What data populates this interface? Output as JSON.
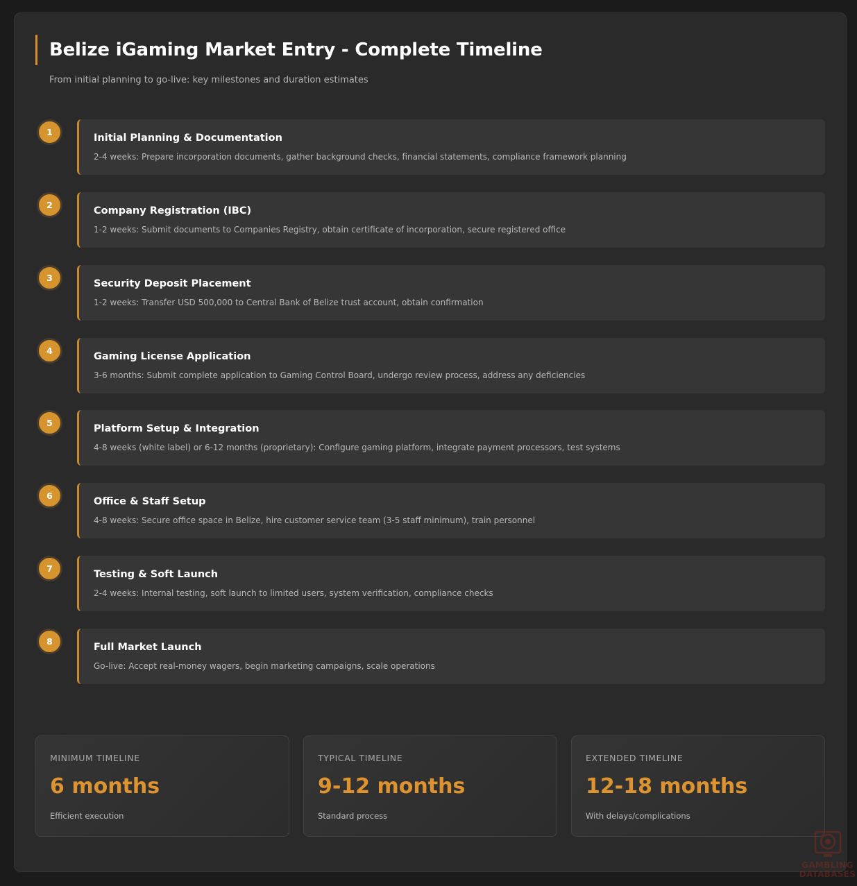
{
  "header": {
    "title": "Belize iGaming Market Entry - Complete Timeline",
    "subtitle": "From initial planning to go-live: key milestones and duration estimates"
  },
  "milestones": [
    {
      "number": "1",
      "title": "Initial Planning & Documentation",
      "description": "2-4 weeks: Prepare incorporation documents, gather background checks, financial statements, compliance framework planning"
    },
    {
      "number": "2",
      "title": "Company Registration (IBC)",
      "description": "1-2 weeks: Submit documents to Companies Registry, obtain certificate of incorporation, secure registered office"
    },
    {
      "number": "3",
      "title": "Security Deposit Placement",
      "description": "1-2 weeks: Transfer USD 500,000 to Central Bank of Belize trust account, obtain confirmation"
    },
    {
      "number": "4",
      "title": "Gaming License Application",
      "description": "3-6 months: Submit complete application to Gaming Control Board, undergo review process, address any deficiencies"
    },
    {
      "number": "5",
      "title": "Platform Setup & Integration",
      "description": "4-8 weeks (white label) or 6-12 months (proprietary): Configure gaming platform, integrate payment processors, test systems"
    },
    {
      "number": "6",
      "title": "Office & Staff Setup",
      "description": "4-8 weeks: Secure office space in Belize, hire customer service team (3-5 staff minimum), train personnel"
    },
    {
      "number": "7",
      "title": "Testing & Soft Launch",
      "description": "2-4 weeks: Internal testing, soft launch to limited users, system verification, compliance checks"
    },
    {
      "number": "8",
      "title": "Full Market Launch",
      "description": "Go-live: Accept real-money wagers, begin marketing campaigns, scale operations"
    }
  ],
  "stats": [
    {
      "label": "MINIMUM TIMELINE",
      "value": "6 months",
      "note": "Efficient execution"
    },
    {
      "label": "TYPICAL TIMELINE",
      "value": "9-12 months",
      "note": "Standard process"
    },
    {
      "label": "EXTENDED TIMELINE",
      "value": "12-18 months",
      "note": "With delays/complications"
    }
  ],
  "watermark": {
    "line1": "GAMBLING",
    "line2": "DATABASES",
    "icon": "roulette-chip-icon"
  },
  "colors": {
    "accent": "#d6942e",
    "background": "#1b1b1b",
    "card": "#2a2a2a",
    "milestone_bg": "#363636"
  }
}
